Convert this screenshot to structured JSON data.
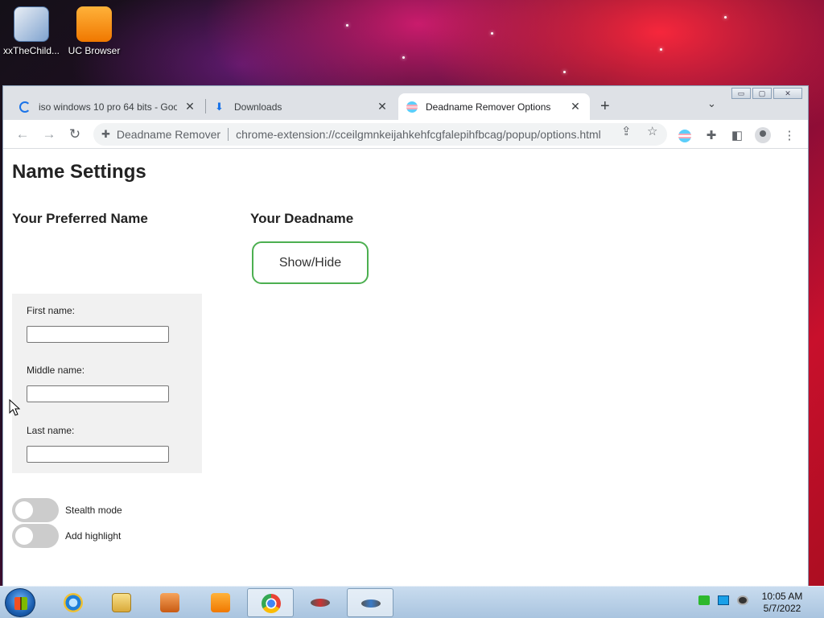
{
  "desktop": {
    "icons": [
      {
        "label": "xxTheChild...",
        "icon": "window-cleaner-icon"
      },
      {
        "label": "UC Browser",
        "icon": "uc-browser-icon"
      }
    ]
  },
  "browser": {
    "tabs": [
      {
        "title": "iso windows 10 pro 64 bits - Goo",
        "icon": "loading-spinner-icon",
        "close": "✕"
      },
      {
        "title": "Downloads",
        "icon": "download-icon",
        "close": "✕"
      },
      {
        "title": "Deadname Remover Options",
        "icon": "trans-flag-icon",
        "close": "✕",
        "active": true
      }
    ],
    "new_tab": "+",
    "tab_search": "⌄",
    "toolbar": {
      "back": "←",
      "forward": "→",
      "reload": "↻",
      "extension_name": "Deadname Remover",
      "url": "chrome-extension://cceilgmnkeijahkehfcgfalepihfbcag/popup/options.html",
      "share": "⇪",
      "bookmark": "☆",
      "extensions": "✚",
      "side_panel": "◧",
      "menu": "⋮"
    }
  },
  "page": {
    "title": "Name Settings",
    "preferred_heading": "Your Preferred Name",
    "deadname_heading": "Your Deadname",
    "show_hide_label": "Show/Hide",
    "fields": {
      "first_label": "First name:",
      "middle_label": "Middle name:",
      "last_label": "Last name:",
      "first_value": "",
      "middle_value": "",
      "last_value": ""
    },
    "toggles": {
      "stealth_label": "Stealth mode",
      "stealth_on": false,
      "highlight_label": "Add highlight",
      "highlight_on": false
    }
  },
  "taskbar": {
    "time": "10:05 AM",
    "date": "5/7/2022",
    "apps": [
      "internet-explorer-icon",
      "file-explorer-icon",
      "media-player-icon",
      "uc-browser-icon",
      "chrome-icon",
      "fish-app-icon",
      "fish-app-icon"
    ]
  }
}
